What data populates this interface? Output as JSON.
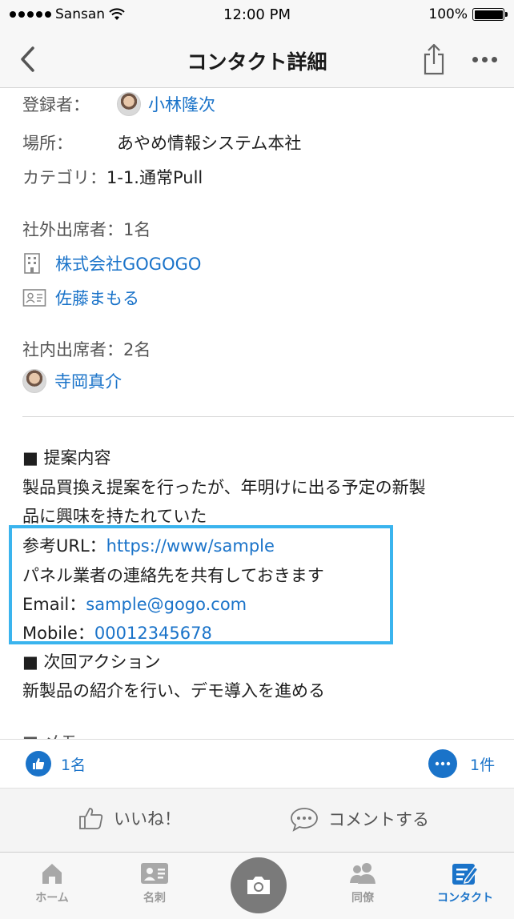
{
  "status_bar": {
    "carrier": "Sansan",
    "time": "12:00 PM",
    "battery": "100%"
  },
  "nav": {
    "title": "コンタクト詳細"
  },
  "details": {
    "registrant_label": "登録者：",
    "registrant_name": "小林隆次",
    "location_label": "場所：",
    "location_value": "あやめ情報システム本社",
    "category_label": "カテゴリ：",
    "category_value": "1-1.通常Pull"
  },
  "external_attendees": {
    "heading": "社外出席者：1名",
    "company": "株式会社GOGOGO",
    "person": "佐藤まもる"
  },
  "internal_attendees": {
    "heading": "社内出席者：2名",
    "person": "寺岡真介"
  },
  "memo": {
    "proposal_heading": "■ 提案内容",
    "proposal_line1": "製品買換え提案を行ったが、年明けに出る予定の新製",
    "proposal_line2": "品に興味を持たれていた",
    "url_label": "参考URL：",
    "url_value": "https://www/sample",
    "share_line": "パネル業者の連絡先を共有しておきます",
    "email_label": "Email：",
    "email_value": "sample@gogo.com",
    "mobile_label": "Mobile：",
    "mobile_value": "00012345678",
    "next_heading": "■ 次回アクション",
    "next_line": "新製品の紹介を行い、デモ導入を進める",
    "cutoff_line": "■ メモ"
  },
  "reactions": {
    "like_count": "1名",
    "comment_count": "1件"
  },
  "actions": {
    "like_label": "いいね！",
    "comment_label": "コメントする"
  },
  "tabs": [
    {
      "label": "ホーム",
      "icon": "home-icon"
    },
    {
      "label": "名刺",
      "icon": "business-card-icon"
    },
    {
      "label": "",
      "icon": "camera-icon"
    },
    {
      "label": "同僚",
      "icon": "colleagues-icon"
    },
    {
      "label": "コンタクト",
      "icon": "contact-edit-icon"
    }
  ],
  "colors": {
    "link": "#1a73c9",
    "highlight": "#3ab4ee",
    "active_tab": "#1a73c9",
    "inactive_tab": "#9a9a9a"
  }
}
